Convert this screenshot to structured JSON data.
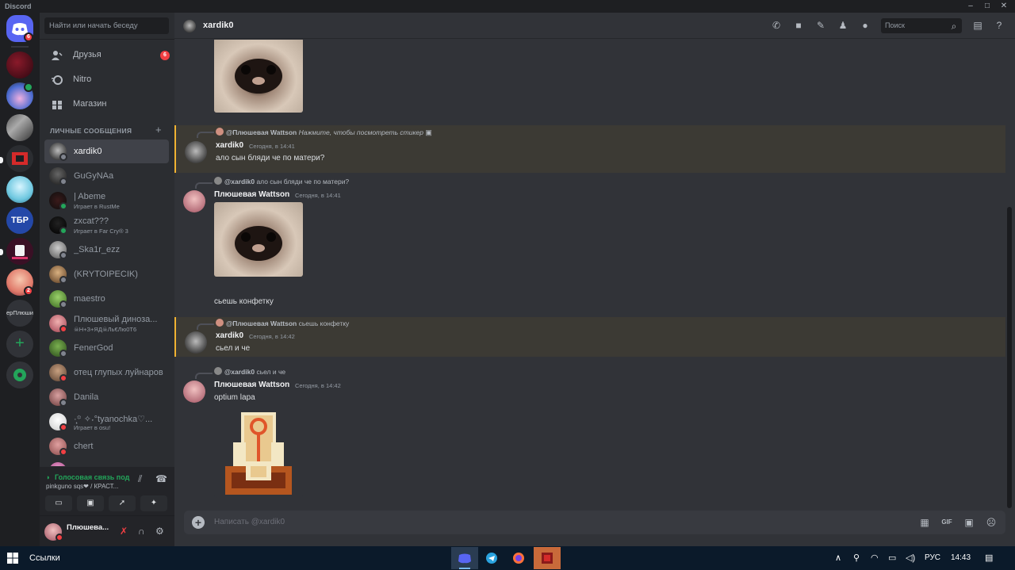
{
  "window": {
    "title": "Discord"
  },
  "guilds": {
    "home_badge": "6",
    "badge_2": "2",
    "text_server": "ерПлюши"
  },
  "sidebar": {
    "search_placeholder": "Найти или начать беседу",
    "nav": [
      {
        "label": "Друзья",
        "badge": "6"
      },
      {
        "label": "Nitro"
      },
      {
        "label": "Магазин"
      }
    ],
    "dm_header": "ЛИЧНЫЕ СООБЩЕНИЯ",
    "dms": [
      {
        "name": "xardik0",
        "status": "offline"
      },
      {
        "name": "GuGyNAa",
        "status": "offline"
      },
      {
        "name": "| Abeme",
        "sub": "Играет в RustMe",
        "status": "online"
      },
      {
        "name": "zxcat???",
        "sub": "Играет в Far Cry® 3",
        "status": "online"
      },
      {
        "name": "_Ska1r_ezz",
        "status": "offline"
      },
      {
        "name": "(KRYTOIPECIK)",
        "status": "offline"
      },
      {
        "name": "maestro",
        "status": "offline"
      },
      {
        "name": "Плюшевый диноза...",
        "sub": "☠Н+З+ЯД☠Ль€Лю0Т6",
        "status": "dnd"
      },
      {
        "name": "FenerGod",
        "status": "offline"
      },
      {
        "name": "отец глупых луйнаров",
        "status": "dnd"
      },
      {
        "name": "Danila",
        "status": "offline"
      },
      {
        "name": "·̩͙꙳ ✧˖°tyanochka♡...",
        "sub": "Играет в osu!",
        "status": "dnd"
      },
      {
        "name": "chert",
        "status": "dnd"
      },
      {
        "name": "○○○○○○",
        "status": "offline"
      }
    ]
  },
  "voice": {
    "status": "Голосовая связь под",
    "channel": "pinkguno sqs❤ / КРАСТ..."
  },
  "user": {
    "name": "Плюшева..."
  },
  "chat": {
    "recipient": "xardik0",
    "search_placeholder": "Поиск",
    "composer_placeholder": "Написать @xardik0",
    "messages": [
      {
        "reply_name": "@Плюшевая Wattson",
        "reply_text": "Нажмите, чтобы посмотреть стикер",
        "author": "xardik0",
        "time": "Сегодня, в 14:41",
        "text": "ало сын бляди че по матери?"
      },
      {
        "reply_name": "@xardik0",
        "reply_text": "ало сын бляди че по матери?",
        "author": "Плюшевая Wattson",
        "time": "Сегодня, в 14:41",
        "text": "сьешь конфетку"
      },
      {
        "reply_name": "@Плюшевая Wattson",
        "reply_text": "сьешь конфетку",
        "author": "xardik0",
        "time": "Сегодня, в 14:42",
        "text": "сьел и че"
      },
      {
        "reply_name": "@xardik0",
        "reply_text": "сьел и че",
        "author": "Плюшевая Wattson",
        "time": "Сегодня, в 14:42",
        "text": "optium lapa"
      }
    ]
  },
  "taskbar": {
    "search_label": "Ссылки",
    "language": "РУС",
    "clock": "14:43"
  }
}
